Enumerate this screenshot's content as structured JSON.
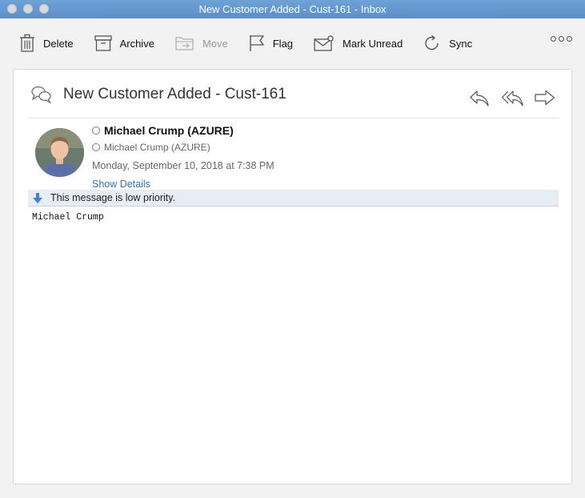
{
  "window": {
    "title": "New Customer Added - Cust-161 - Inbox"
  },
  "toolbar": {
    "delete_label": "Delete",
    "archive_label": "Archive",
    "move_label": "Move",
    "flag_label": "Flag",
    "mark_unread_label": "Mark Unread",
    "sync_label": "Sync"
  },
  "message": {
    "subject": "New Customer Added - Cust-161",
    "sender_name": "Michael Crump (AZURE)",
    "recipient": "Michael Crump (AZURE)",
    "date": "Monday, September 10, 2018 at 7:38 PM",
    "show_details": "Show Details",
    "priority_notice": "This message is low priority.",
    "body": "Michael Crump"
  },
  "colors": {
    "titlebar": "#6a9ed3",
    "link": "#2f72c4",
    "priority_bg": "#e7edf5",
    "priority_icon": "#3f7fd8"
  }
}
